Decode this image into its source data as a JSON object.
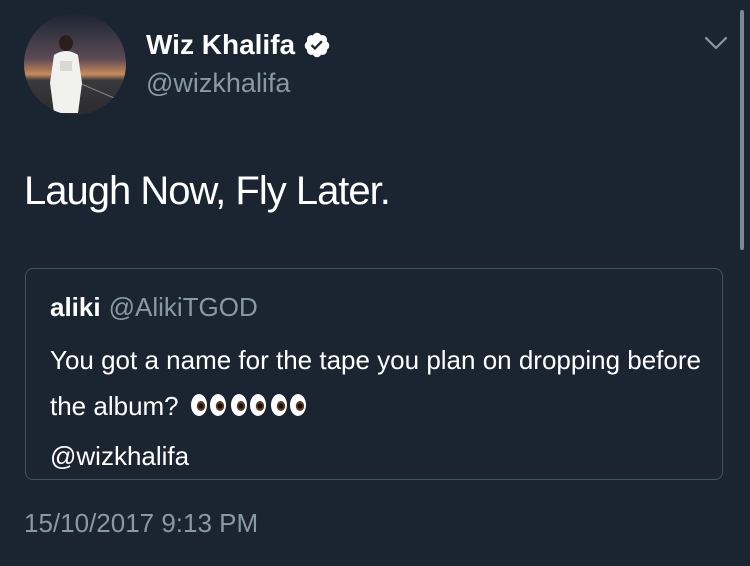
{
  "tweet": {
    "author": {
      "display_name": "Wiz Khalifa",
      "handle": "@wizkhalifa",
      "verified": true,
      "avatar_icon": "profile-photo"
    },
    "text": "Laugh Now, Fly Later.",
    "quoted": {
      "name": "aliki",
      "handle": "@AlikiTGOD",
      "text_before_emoji": "You got a name for the tape you plan on dropping before the album?",
      "emoji": "👀👀👀",
      "mention": "@wizkhalifa"
    },
    "timestamp": "15/10/2017 9:13 PM",
    "menu_icon": "chevron-down-icon"
  },
  "colors": {
    "background": "#1b2431",
    "secondary_text": "#8899a6",
    "border": "#3d5466",
    "verified_badge": "#ffffff"
  }
}
